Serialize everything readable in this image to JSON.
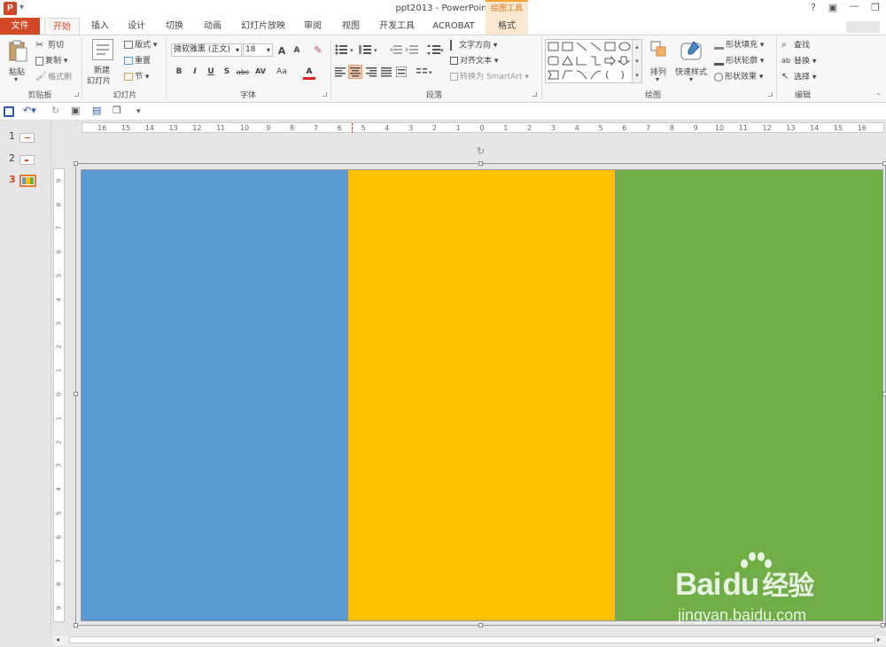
{
  "window": {
    "title": "ppt2013 - PowerPoint",
    "app_icon": "P",
    "contextual_group": "绘图工具",
    "help": "?",
    "restore": "▣",
    "min": "—",
    "max": "❐"
  },
  "tabs": [
    "文件",
    "开始",
    "插入",
    "设计",
    "切换",
    "动画",
    "幻灯片放映",
    "审阅",
    "视图",
    "开发工具",
    "ACROBAT",
    "格式"
  ],
  "ribbon": {
    "clipboard": {
      "paste": "粘贴",
      "cut": "剪切",
      "copy": "复制",
      "format_painter": "格式刷",
      "label": "剪贴板"
    },
    "slides": {
      "new_slide_1": "新建",
      "new_slide_2": "幻灯片",
      "layout": "版式",
      "reset": "重置",
      "section": "节",
      "label": "幻灯片"
    },
    "font": {
      "name": "微软雅黑 (正文)",
      "size": "18",
      "grow": "A",
      "shrink": "A",
      "clear": "✎",
      "bold": "B",
      "italic": "I",
      "underline": "U",
      "shadow": "S",
      "strike": "abc",
      "spacing": "AV",
      "case": "Aa",
      "color": "A",
      "label": "字体"
    },
    "paragraph": {
      "text_direction": "文字方向",
      "align_text": "对齐文本",
      "smartart": "转换为 SmartArt",
      "label": "段落"
    },
    "drawing": {
      "arrange": "排列",
      "quick_styles": "快速样式",
      "fill": "形状填充",
      "outline": "形状轮廓",
      "effects": "形状效果",
      "label": "绘图"
    },
    "editing": {
      "find": "查找",
      "replace": "替换",
      "select": "选择",
      "label": "编辑"
    }
  },
  "thumbnails": [
    {
      "num": "1"
    },
    {
      "num": "2"
    },
    {
      "num": "3",
      "active": true
    }
  ],
  "hruler": [
    "16",
    "15",
    "14",
    "13",
    "12",
    "11",
    "10",
    "9",
    "8",
    "7",
    "6",
    "5",
    "4",
    "3",
    "2",
    "1",
    "0",
    "1",
    "2",
    "3",
    "4",
    "5",
    "6",
    "7",
    "8",
    "9",
    "10",
    "11",
    "12",
    "13",
    "14",
    "15",
    "16"
  ],
  "vruler": [
    "9",
    "8",
    "7",
    "6",
    "5",
    "4",
    "3",
    "2",
    "1",
    "0",
    "1",
    "2",
    "3",
    "4",
    "5",
    "6",
    "7",
    "8",
    "9"
  ],
  "slide": {
    "columns": [
      {
        "color": "#5b9bd5"
      },
      {
        "color": "#ffc000"
      },
      {
        "color": "#70ad47"
      }
    ]
  },
  "watermark": {
    "main": "Bai",
    "paw": "du",
    "tail": "经验",
    "url": "jingyan.baidu.com"
  }
}
